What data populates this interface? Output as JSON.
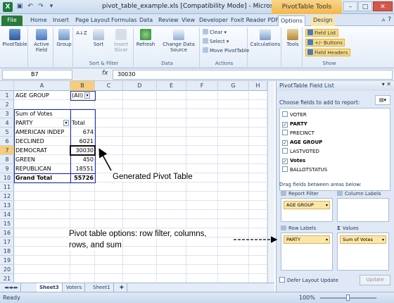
{
  "window": {
    "title": "pivot_table_example.xls [Compatibility Mode] - Microsoft Excel",
    "context_tool_title": "PivotTable Tools",
    "app_icon_letter": "X"
  },
  "tabs": [
    "File",
    "Home",
    "Insert",
    "Page Layout",
    "Formulas",
    "Data",
    "Review",
    "View",
    "Developer",
    "Foxit Reader PDF",
    "Options",
    "Design"
  ],
  "active_tab": "Options",
  "ribbon": {
    "pivot_table": "PivotTable",
    "active_field": "Active Field",
    "group": "Group",
    "sort_az": "A↓Z",
    "sort": "Sort",
    "insert_slicer": "Insert Slicer",
    "sort_filter_label": "Sort & Filter",
    "refresh": "Refresh",
    "change_data_source": "Change Data Source",
    "data_label": "Data",
    "clear": "Clear",
    "select": "Select",
    "move_pivottable": "Move PivotTable",
    "actions_label": "Actions",
    "calculations": "Calculations",
    "tools": "Tools",
    "field_list": "Field List",
    "plus_minus_buttons": "+/- Buttons",
    "field_headers": "Field Headers",
    "show_label": "Show"
  },
  "formula_bar": {
    "name_box": "B7",
    "fx": "fx",
    "value": "30030"
  },
  "columns": [
    "A",
    "B",
    "C",
    "D",
    "E",
    "F",
    "G",
    "H"
  ],
  "selected_column": "B",
  "rows": [
    "1",
    "2",
    "3",
    "4",
    "5",
    "6",
    "7",
    "8",
    "9",
    "10",
    "11",
    "12",
    "13",
    "14",
    "15",
    "16",
    "17",
    "18",
    "19",
    "20",
    "21"
  ],
  "selected_row": "7",
  "pivot": {
    "filter_field": "AGE GROUP",
    "filter_value": "(All)",
    "values_header": "Sum of Votes",
    "row_header": "PARTY",
    "total_header": "Total",
    "data": [
      {
        "party": "AMERICAN INDEP",
        "total": "674"
      },
      {
        "party": "DECLINED",
        "total": "6021"
      },
      {
        "party": "DEMOCRAT",
        "total": "30030"
      },
      {
        "party": "GREEN",
        "total": "450"
      },
      {
        "party": "REPUBLICAN",
        "total": "18551"
      }
    ],
    "grand_total_label": "Grand Total",
    "grand_total": "55726"
  },
  "sheet_tabs": [
    "Sheet3",
    "Voters",
    "Sheet1"
  ],
  "active_sheet": "Sheet3",
  "status": {
    "ready": "Ready",
    "zoom": "100%"
  },
  "field_list": {
    "title": "PivotTable Field List",
    "choose_label": "Choose fields to add to report:",
    "fields": [
      {
        "name": "VOTER",
        "checked": false
      },
      {
        "name": "PARTY",
        "checked": true
      },
      {
        "name": "PRECINCT",
        "checked": false
      },
      {
        "name": "AGE GROUP",
        "checked": true
      },
      {
        "name": "LASTVOTED",
        "checked": false
      },
      {
        "name": "Votes",
        "checked": true
      },
      {
        "name": "BALLOTSTATUS",
        "checked": false
      }
    ],
    "drag_label": "Drag fields between areas below:",
    "report_filter": "Report Filter",
    "column_labels": "Column Labels",
    "row_labels": "Row Labels",
    "values": "Values",
    "report_filter_item": "AGE GROUP",
    "row_labels_item": "PARTY",
    "values_item": "Sum of Votes",
    "defer_label": "Defer Layout Update",
    "update": "Update"
  },
  "annotations": {
    "generated": "Generated Pivot Table",
    "options_line1": "Pivot table options: row filter, columns,",
    "options_line2": "rows, and sum"
  }
}
